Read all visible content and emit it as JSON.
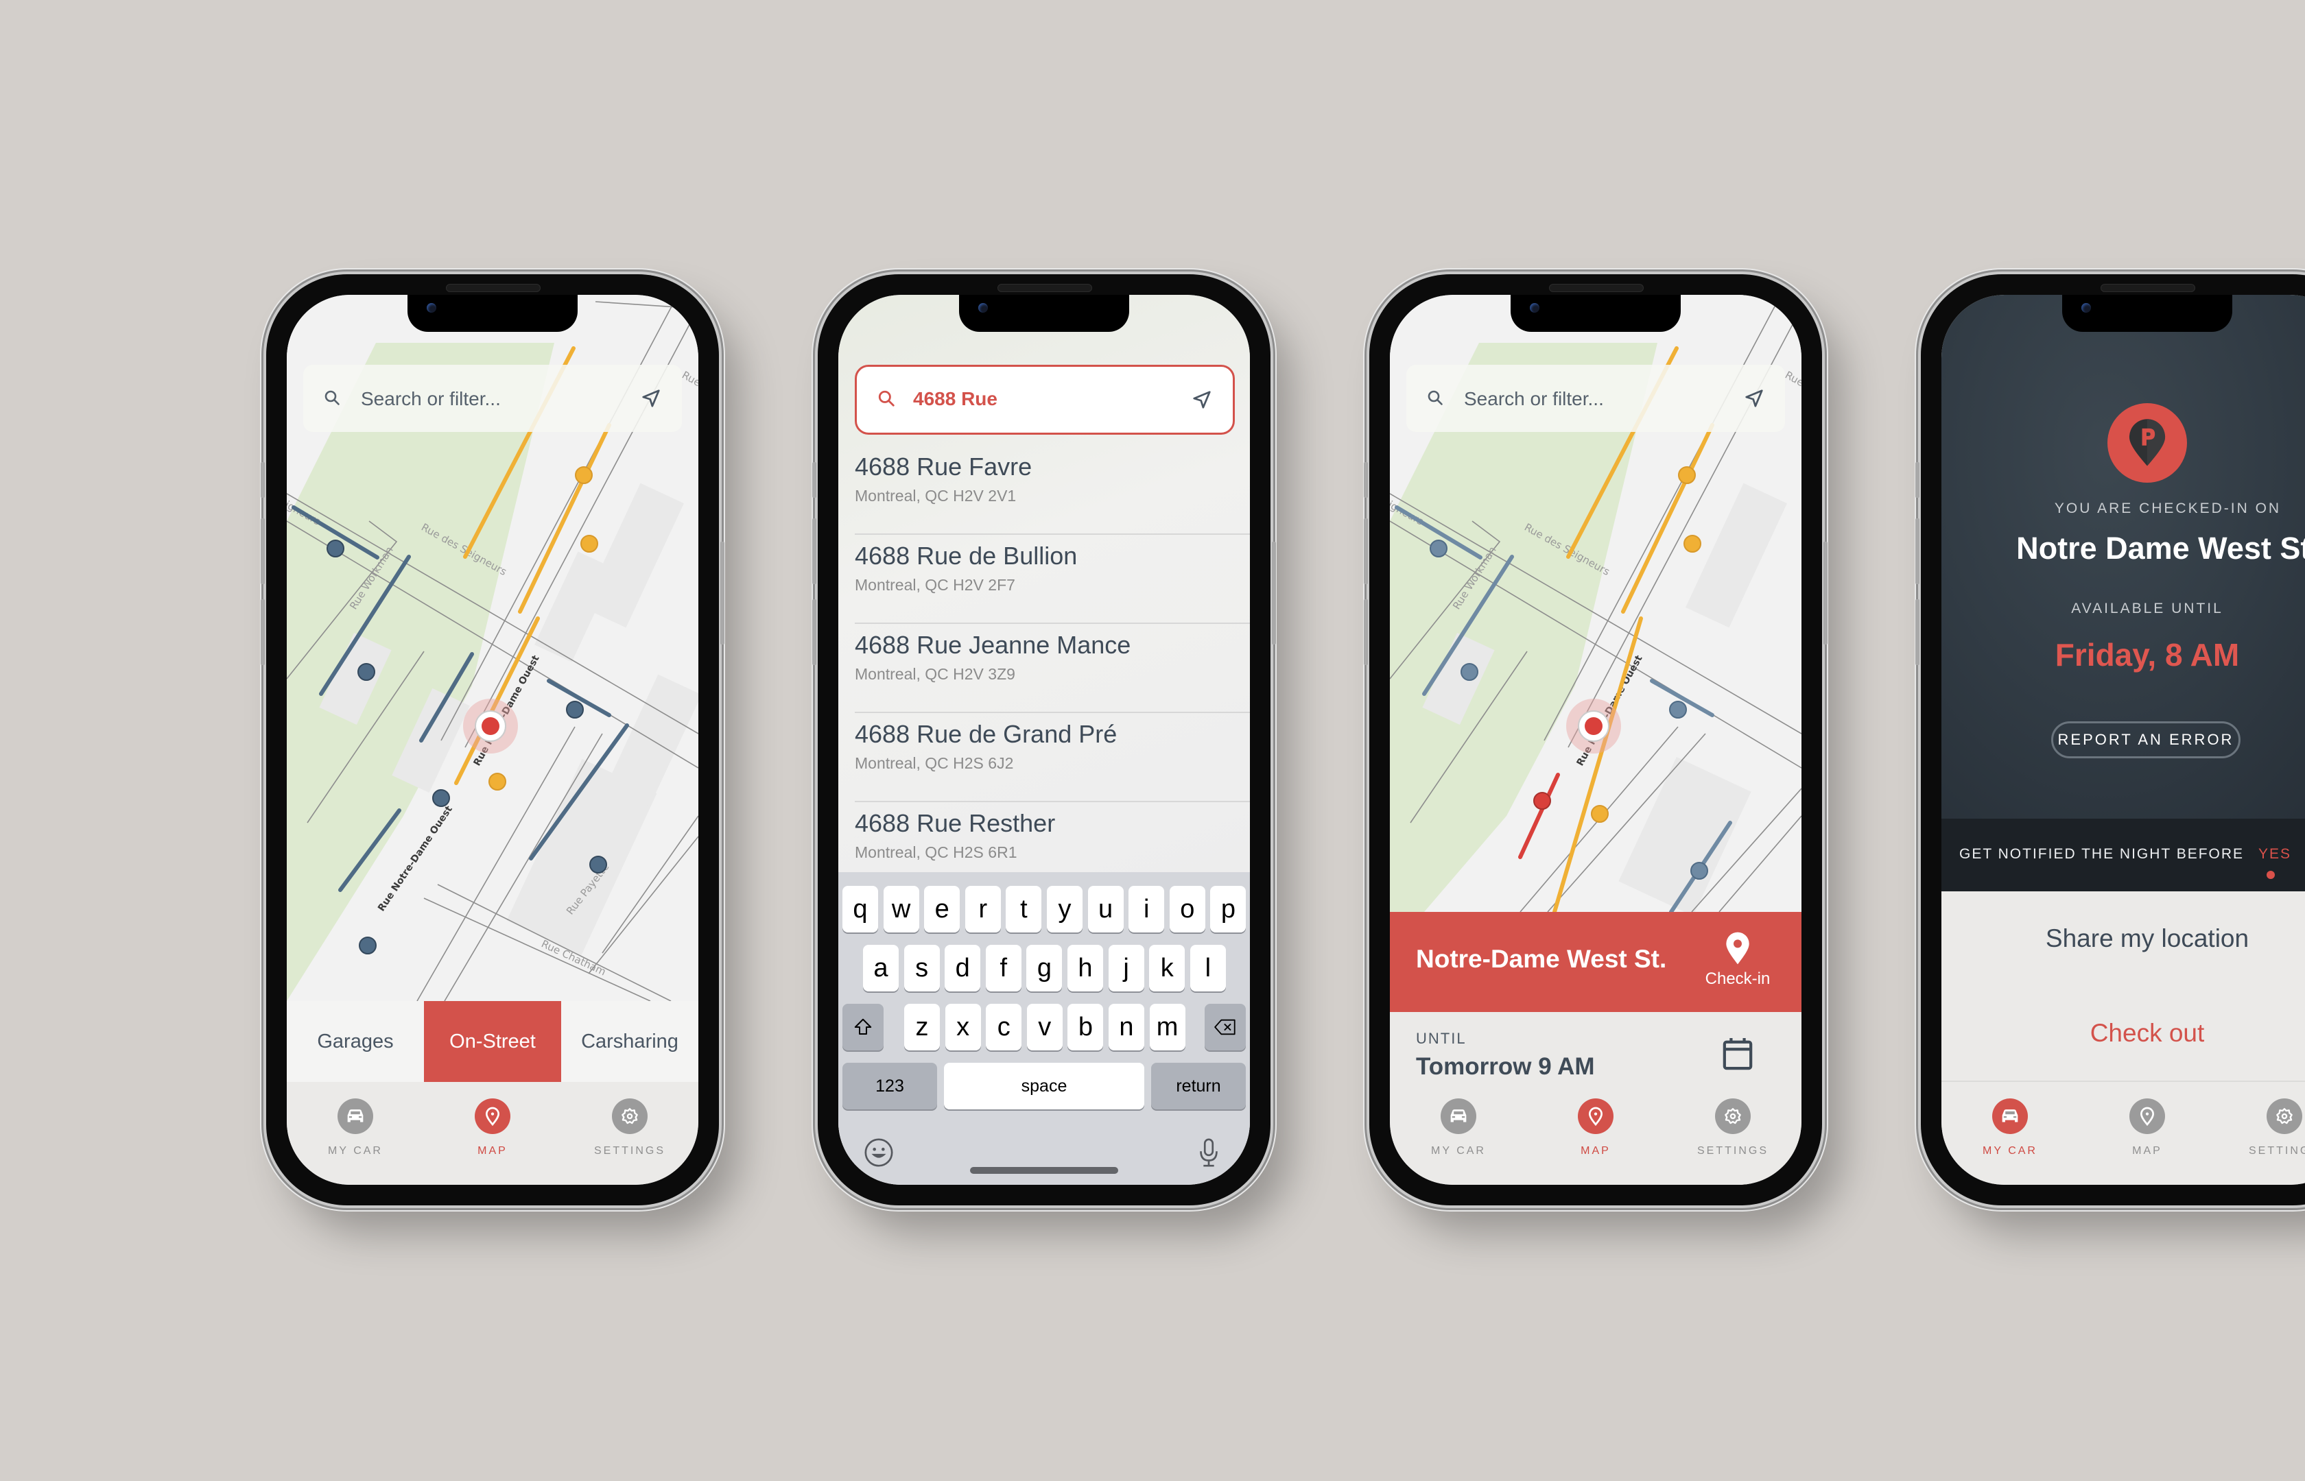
{
  "colors": {
    "accent": "#d3524b",
    "background": "#d3cfcb",
    "text_dark": "#3e4a57",
    "parking_free": "#4f6b85",
    "parking_paid": "#f0b035"
  },
  "map": {
    "street_labels": [
      "Rue des Seigneurs",
      "Rue des Seigneurs",
      "Rue Workman",
      "Rue Notre-Dame Ouest",
      "Rue Notre-Dame Ouest",
      "Rue Payette",
      "Rue Chatham",
      "Rue"
    ]
  },
  "screen1": {
    "search": {
      "placeholder": "Search or filter...",
      "search_icon": "search-icon",
      "location_icon": "navigation-arrow-icon"
    },
    "segments": [
      {
        "label": "Garages",
        "active": false
      },
      {
        "label": "On-Street",
        "active": true
      },
      {
        "label": "Carsharing",
        "active": false
      }
    ],
    "tabs": [
      {
        "label": "MY CAR",
        "icon": "car-icon",
        "active": false
      },
      {
        "label": "MAP",
        "icon": "map-pin-icon",
        "active": true
      },
      {
        "label": "SETTINGS",
        "icon": "gear-icon",
        "active": false
      }
    ]
  },
  "screen2": {
    "search": {
      "value": "4688 Rue"
    },
    "results": [
      {
        "title": "4688 Rue Favre",
        "subtitle": "Montreal, QC H2V 2V1"
      },
      {
        "title": "4688 Rue de Bullion",
        "subtitle": "Montreal, QC H2V 2F7"
      },
      {
        "title": "4688 Rue Jeanne Mance",
        "subtitle": "Montreal, QC  H2V 3Z9"
      },
      {
        "title": "4688 Rue de Grand Pré",
        "subtitle": "Montreal, QC  H2S 6J2"
      },
      {
        "title": "4688 Rue Resther",
        "subtitle": "Montreal, QC  H2S 6R1"
      }
    ],
    "keyboard": {
      "row1": [
        "q",
        "w",
        "e",
        "r",
        "t",
        "y",
        "u",
        "i",
        "o",
        "p"
      ],
      "row2": [
        "a",
        "s",
        "d",
        "f",
        "g",
        "h",
        "j",
        "k",
        "l"
      ],
      "row3": [
        "z",
        "x",
        "c",
        "v",
        "b",
        "n",
        "m"
      ],
      "numbers_label": "123",
      "space_label": "space",
      "return_label": "return"
    }
  },
  "screen3": {
    "search": {
      "placeholder": "Search or filter..."
    },
    "spot": {
      "street": "Notre-Dame West St.",
      "checkin_label": "Check-in"
    },
    "until": {
      "label": "UNTIL",
      "value": "Tomorrow 9 AM"
    },
    "tabs": [
      {
        "label": "MY CAR",
        "active": false
      },
      {
        "label": "MAP",
        "active": true
      },
      {
        "label": "SETTINGS",
        "active": false
      }
    ]
  },
  "screen4": {
    "caption": "YOU ARE CHECKED-IN ON",
    "street": "Notre Dame West St.",
    "available_label": "AVAILABLE UNTIL",
    "available_value": "Friday, 8 AM",
    "report_button": "REPORT AN ERROR",
    "notify_label": "GET NOTIFIED THE NIGHT BEFORE",
    "notify_value": "YES",
    "share_button": "Share my location",
    "checkout_button": "Check out",
    "tabs": [
      {
        "label": "MY CAR",
        "active": true
      },
      {
        "label": "MAP",
        "active": false
      },
      {
        "label": "SETTINGS",
        "active": false
      }
    ]
  }
}
